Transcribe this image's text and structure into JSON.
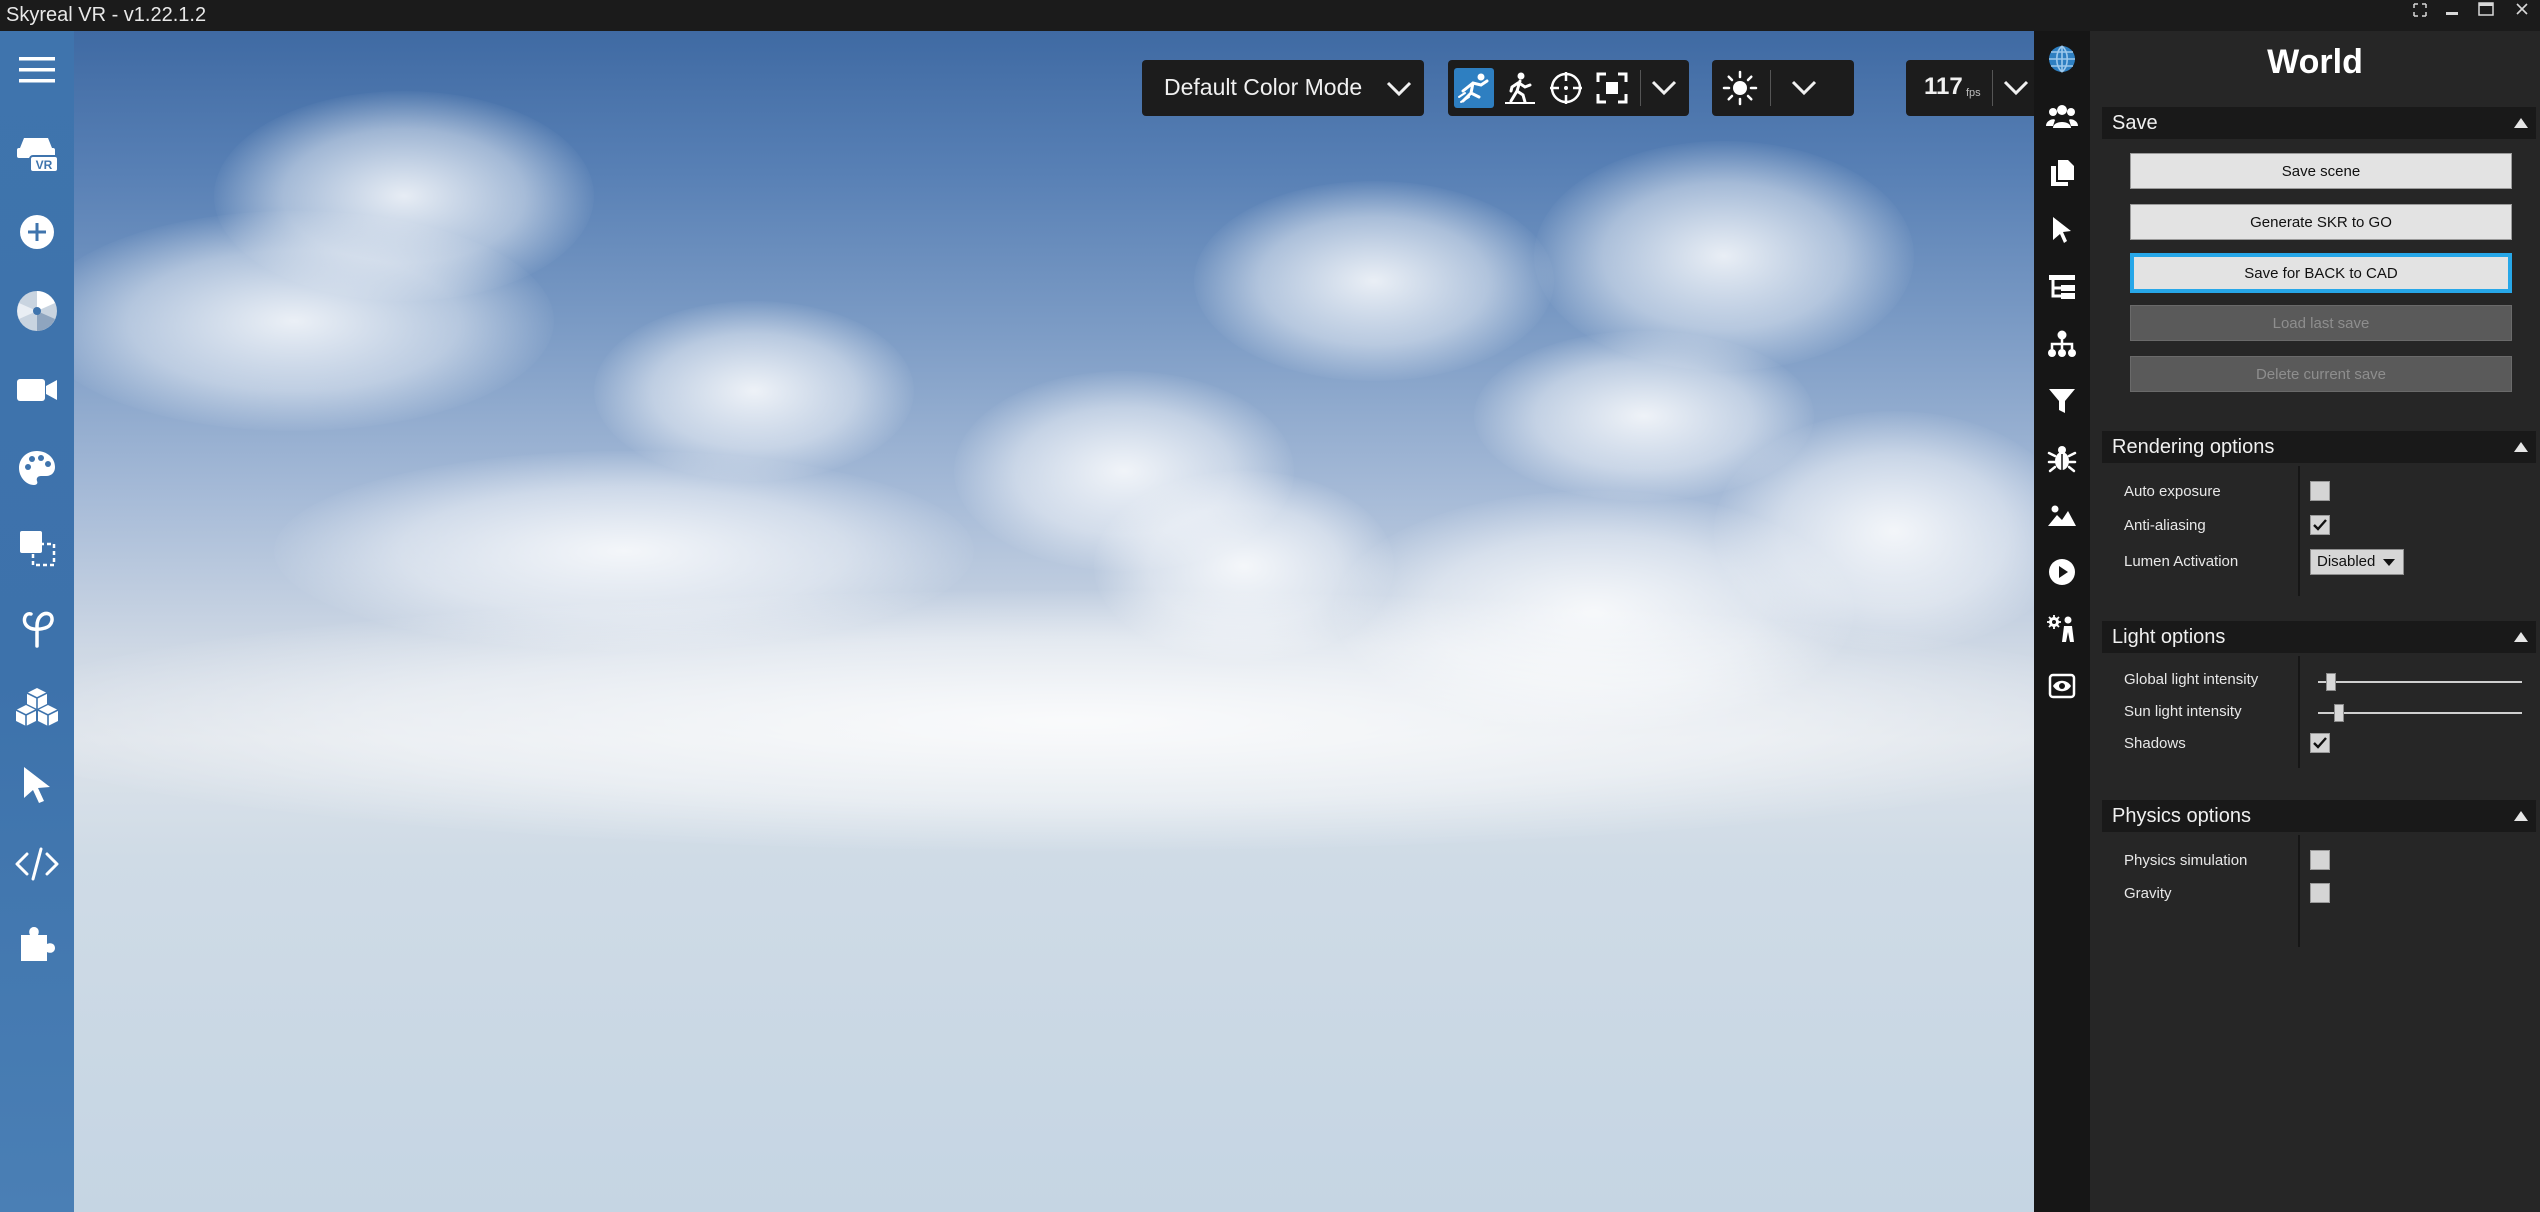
{
  "window": {
    "title": "Skyreal VR - v1.22.1.2"
  },
  "left_toolbar": {
    "items": [
      {
        "icon": "hamburger-menu-icon"
      },
      {
        "icon": "vr-headset-car-icon",
        "badge": "VR"
      },
      {
        "icon": "add-circle-icon"
      },
      {
        "icon": "pie-segments-icon"
      },
      {
        "icon": "video-camera-icon"
      },
      {
        "icon": "palette-icon"
      },
      {
        "icon": "select-region-icon"
      },
      {
        "icon": "phi-icon"
      },
      {
        "icon": "cubes-icon"
      },
      {
        "icon": "cursor-arrow-icon"
      },
      {
        "icon": "code-icon"
      },
      {
        "icon": "puzzle-piece-icon"
      }
    ]
  },
  "viewport": {
    "color_mode": "Default Color Mode",
    "fps_value": "117",
    "fps_unit": "fps",
    "nav_modes": [
      "fly-mode-icon",
      "walk-mode-icon",
      "crosshair-target-icon",
      "fullscreen-focus-icon"
    ],
    "active_nav_mode": "fly-mode-icon"
  },
  "right_iconbar": {
    "items": [
      "globe-icon",
      "users-icon",
      "copy-files-icon",
      "pointer-icon",
      "hierarchy-tree-icon",
      "org-chart-icon",
      "filter-icon",
      "bug-icon",
      "landscape-image-icon",
      "play-circle-icon",
      "avatar-settings-icon",
      "eye-view-icon"
    ],
    "active": "globe-icon"
  },
  "panel": {
    "title": "World",
    "save": {
      "header": "Save",
      "buttons": {
        "save_scene": "Save scene",
        "generate_skr": "Generate SKR to GO",
        "save_back_to_cad": "Save for BACK to CAD",
        "load_last_save": "Load last save",
        "delete_current_save": "Delete current save"
      }
    },
    "rendering": {
      "header": "Rendering options",
      "auto_exposure_label": "Auto exposure",
      "auto_exposure_checked": false,
      "anti_aliasing_label": "Anti-aliasing",
      "anti_aliasing_checked": true,
      "lumen_label": "Lumen Activation",
      "lumen_value": "Disabled"
    },
    "light": {
      "header": "Light options",
      "global_intensity_label": "Global light intensity",
      "global_intensity_value": 0.04,
      "sun_intensity_label": "Sun light intensity",
      "sun_intensity_value": 0.08,
      "shadows_label": "Shadows",
      "shadows_checked": true
    },
    "physics": {
      "header": "Physics options",
      "simulation_label": "Physics simulation",
      "simulation_checked": false,
      "gravity_label": "Gravity",
      "gravity_checked": false
    }
  },
  "colors": {
    "accent": "#27a7e8",
    "active_mode_bg": "#2e7fc1",
    "left_toolbar": "#3f74ad",
    "panel_bg": "#262626",
    "section_header_bg": "#191919"
  }
}
